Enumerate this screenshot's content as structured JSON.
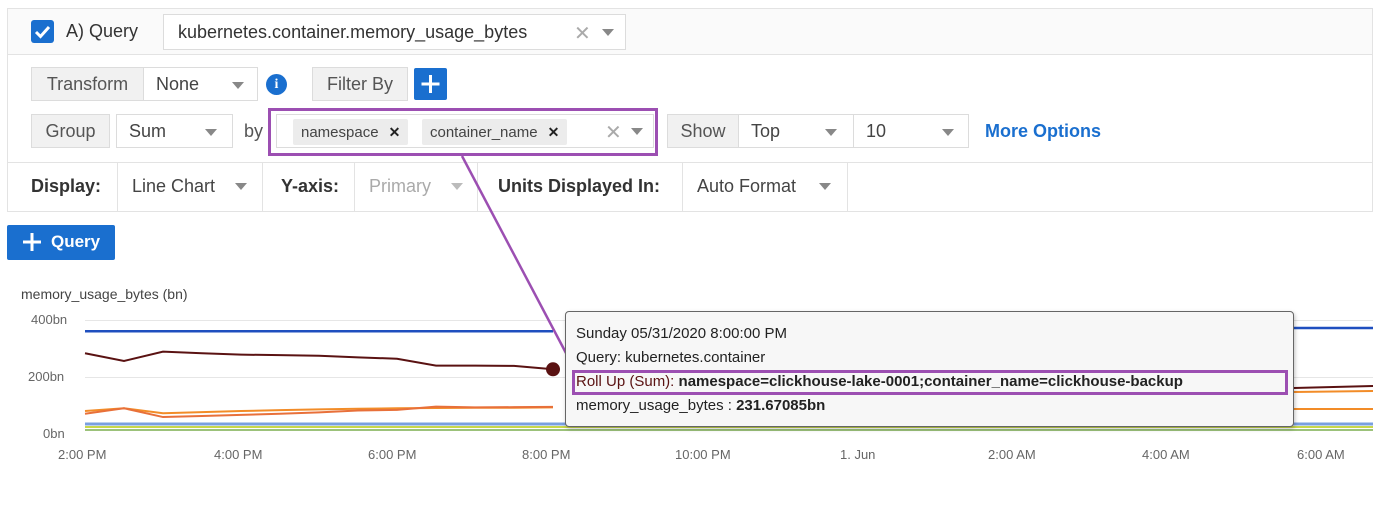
{
  "query": {
    "checked": true,
    "label": "A) Query",
    "metric": "kubernetes.container.memory_usage_bytes"
  },
  "transform": {
    "label": "Transform",
    "value": "None"
  },
  "filter": {
    "label": "Filter By"
  },
  "group": {
    "label": "Group",
    "aggregation": "Sum",
    "by_label": "by",
    "chips": [
      "namespace",
      "container_name"
    ]
  },
  "show": {
    "label": "Show",
    "mode": "Top",
    "count": "10"
  },
  "more_options": "More Options",
  "display": {
    "label": "Display:",
    "value": "Line Chart",
    "yaxis_label": "Y-axis:",
    "yaxis_value": "Primary",
    "units_label": "Units Displayed In:",
    "units_value": "Auto Format"
  },
  "add_query": "Query",
  "chart": {
    "ylabel": "memory_usage_bytes (bn)",
    "yticks": [
      "400bn",
      "200bn",
      "0bn"
    ],
    "xticks": [
      "2:00 PM",
      "4:00 PM",
      "6:00 PM",
      "8:00 PM",
      "10:00 PM",
      "1. Jun",
      "2:00 AM",
      "4:00 AM",
      "6:00 AM"
    ]
  },
  "tooltip": {
    "date": "Sunday 05/31/2020 8:00:00 PM",
    "query_line": "Query: kubernetes.container",
    "rollup_label": "Roll Up (Sum): ",
    "rollup_value": "namespace=clickhouse-lake-0001;container_name=clickhouse-backup",
    "metric_label": "memory_usage_bytes : ",
    "metric_value": "231.67085bn"
  },
  "colors": {
    "accent": "#1565c0",
    "highlight": "#9c4fb2",
    "series_dark": "#5a1212",
    "series_orange": "#f28c28",
    "series_blue": "#1f4fbf"
  },
  "chart_data": {
    "type": "line",
    "ylabel": "memory_usage_bytes (bn)",
    "x": [
      "2:00 PM",
      "2:30 PM",
      "3:00 PM",
      "3:30 PM",
      "4:00 PM",
      "4:30 PM",
      "5:00 PM",
      "5:30 PM",
      "6:00 PM",
      "6:30 PM",
      "7:00 PM",
      "7:30 PM",
      "8:00 PM"
    ],
    "ylim": [
      0,
      400
    ],
    "series": [
      {
        "color": "#1f4fbf",
        "values": [
          370,
          370,
          370,
          370,
          370,
          370,
          370,
          370,
          370,
          370,
          370,
          370,
          370
        ]
      },
      {
        "color": "#5a1212",
        "values": [
          290,
          262,
          296,
          290,
          285,
          283,
          281,
          275,
          270,
          245,
          245,
          244,
          231.67
        ]
      },
      {
        "color": "#f28c28",
        "values": [
          80,
          90,
          72,
          76,
          80,
          83,
          86,
          88,
          90,
          91,
          92,
          92,
          93
        ]
      },
      {
        "color": "#e8703a",
        "values": [
          70,
          90,
          58,
          62,
          66,
          70,
          75,
          82,
          84,
          96,
          93,
          94,
          95
        ]
      }
    ]
  }
}
